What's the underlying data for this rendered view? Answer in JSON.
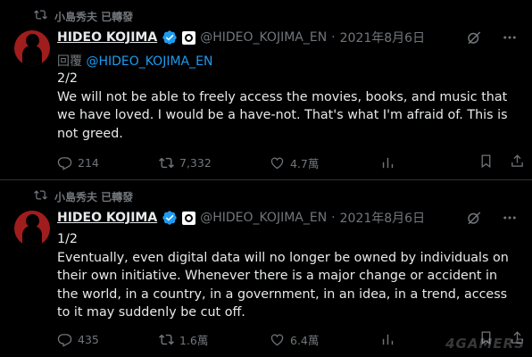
{
  "tweets": [
    {
      "retweeter": "小島秀夫 已轉發",
      "name": "HIDEO KOJIMA",
      "handle": "@HIDEO_KOJIMA_EN",
      "date": "2021年8月6日",
      "reply_prefix": "回覆",
      "reply_handle": "@HIDEO_KOJIMA_EN",
      "part_label": "2/2",
      "body": "We will not be able to freely access the movies, books, and music that we have loved. I would be a have-not. That's what I'm afraid of. This is not greed.",
      "replies": "214",
      "retweets": "7,332",
      "likes": "4.7萬"
    },
    {
      "retweeter": "小島秀夫 已轉發",
      "name": "HIDEO KOJIMA",
      "handle": "@HIDEO_KOJIMA_EN",
      "date": "2021年8月6日",
      "part_label": "1/2",
      "body": "Eventually, even digital data will no longer be owned by individuals on their own initiative. Whenever there is a major change or accident in the world, in a country, in a government, in an idea, in a trend, access to it may suddenly be cut off.",
      "replies": "435",
      "retweets": "1.6萬",
      "likes": "6.4萬"
    }
  ],
  "separator": "·",
  "watermark": "4GAMERS",
  "colors": {
    "background": "#000000",
    "text": "#e7e9ea",
    "muted": "#71767b",
    "link": "#1d9bf0",
    "verified": "#1d9bf0"
  },
  "icons": [
    "retweet-icon",
    "verified-badge-icon",
    "affiliate-badge-icon",
    "grok-icon",
    "more-icon",
    "reply-icon",
    "like-icon",
    "views-icon",
    "bookmark-icon",
    "share-icon"
  ]
}
